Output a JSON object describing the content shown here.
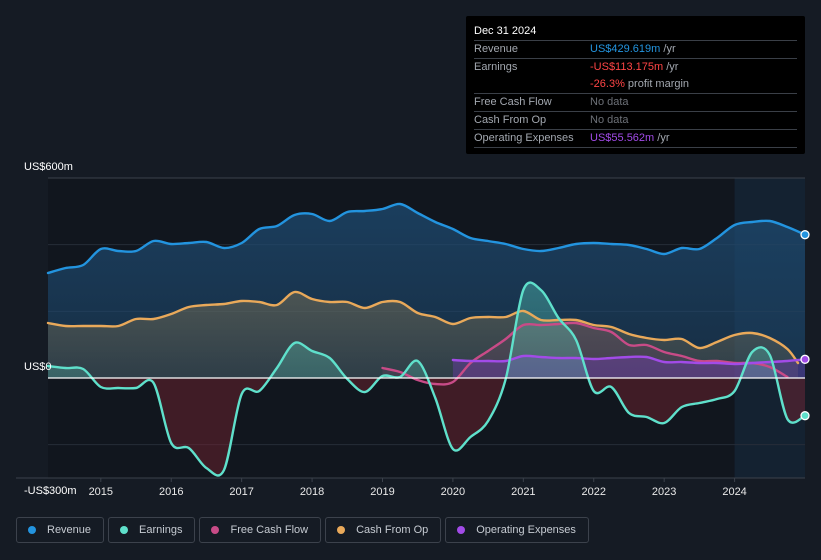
{
  "tooltip": {
    "date": "Dec 31 2024",
    "rows": [
      {
        "label": "Revenue",
        "value": "US$429.619m",
        "suffix": " /yr",
        "color": "#2394df"
      },
      {
        "label": "Earnings",
        "value": "-US$113.175m",
        "suffix": " /yr",
        "color": "#ff4545"
      },
      {
        "label": "",
        "value": "-26.3%",
        "suffix": " profit margin",
        "color": "#ff4545"
      },
      {
        "label": "Free Cash Flow",
        "value": "No data",
        "suffix": "",
        "color": ""
      },
      {
        "label": "Cash From Op",
        "value": "No data",
        "suffix": "",
        "color": ""
      },
      {
        "label": "Operating Expenses",
        "value": "US$55.562m",
        "suffix": " /yr",
        "color": "#a24be8"
      }
    ]
  },
  "legend": [
    {
      "label": "Revenue",
      "color": "#2394df"
    },
    {
      "label": "Earnings",
      "color": "#5fe0cb"
    },
    {
      "label": "Free Cash Flow",
      "color": "#c84b87"
    },
    {
      "label": "Cash From Op",
      "color": "#e9a95a"
    },
    {
      "label": "Operating Expenses",
      "color": "#a24be8"
    }
  ],
  "chart_data": {
    "type": "line",
    "title": "",
    "xlabel": "",
    "ylabel": "",
    "xlim": [
      2014.25,
      2025.0
    ],
    "ylim": [
      -300,
      600
    ],
    "y_labels": [
      {
        "value": 600,
        "label": "US$600m"
      },
      {
        "value": 0,
        "label": "US$0"
      },
      {
        "value": -300,
        "label": "-US$300m"
      }
    ],
    "y_gridlines": [
      600,
      400,
      200,
      0,
      -200,
      -300
    ],
    "x_ticks": [
      2015,
      2016,
      2017,
      2018,
      2019,
      2020,
      2021,
      2022,
      2023,
      2024
    ],
    "x_tick_labels": [
      "2015",
      "2016",
      "2017",
      "2018",
      "2019",
      "2020",
      "2021",
      "2022",
      "2023",
      "2024"
    ],
    "highlight_from": 2024.0,
    "grid": true,
    "legend_position": "bottom-left",
    "series": [
      {
        "name": "Revenue",
        "color": "#2394df",
        "end_marker": true,
        "points": [
          [
            2014.25,
            315
          ],
          [
            2014.5,
            330
          ],
          [
            2014.75,
            339
          ],
          [
            2015.0,
            387
          ],
          [
            2015.25,
            381
          ],
          [
            2015.5,
            381
          ],
          [
            2015.75,
            411
          ],
          [
            2016.0,
            402
          ],
          [
            2016.25,
            405
          ],
          [
            2016.5,
            408
          ],
          [
            2016.75,
            390
          ],
          [
            2017.0,
            405
          ],
          [
            2017.25,
            447
          ],
          [
            2017.5,
            456
          ],
          [
            2017.75,
            489
          ],
          [
            2018.0,
            492
          ],
          [
            2018.25,
            471
          ],
          [
            2018.5,
            498
          ],
          [
            2018.75,
            501
          ],
          [
            2019.0,
            507
          ],
          [
            2019.25,
            522
          ],
          [
            2019.5,
            495
          ],
          [
            2019.75,
            468
          ],
          [
            2020.0,
            447
          ],
          [
            2020.25,
            420
          ],
          [
            2020.5,
            411
          ],
          [
            2020.75,
            402
          ],
          [
            2021.0,
            387
          ],
          [
            2021.25,
            381
          ],
          [
            2021.5,
            390
          ],
          [
            2021.75,
            402
          ],
          [
            2022.0,
            405
          ],
          [
            2022.25,
            402
          ],
          [
            2022.5,
            399
          ],
          [
            2022.75,
            387
          ],
          [
            2023.0,
            372
          ],
          [
            2023.25,
            390
          ],
          [
            2023.5,
            387
          ],
          [
            2023.75,
            420
          ],
          [
            2024.0,
            459
          ],
          [
            2024.25,
            468
          ],
          [
            2024.5,
            471
          ],
          [
            2024.75,
            453
          ],
          [
            2025.0,
            430
          ]
        ]
      },
      {
        "name": "Cash From Op",
        "color": "#e9a95a",
        "end_marker": false,
        "points": [
          [
            2014.25,
            165
          ],
          [
            2014.5,
            156
          ],
          [
            2014.75,
            156
          ],
          [
            2015.0,
            156
          ],
          [
            2015.25,
            156
          ],
          [
            2015.5,
            177
          ],
          [
            2015.75,
            177
          ],
          [
            2016.0,
            192
          ],
          [
            2016.25,
            213
          ],
          [
            2016.5,
            219
          ],
          [
            2016.75,
            222
          ],
          [
            2017.0,
            231
          ],
          [
            2017.25,
            228
          ],
          [
            2017.5,
            219
          ],
          [
            2017.75,
            258
          ],
          [
            2018.0,
            237
          ],
          [
            2018.25,
            228
          ],
          [
            2018.5,
            228
          ],
          [
            2018.75,
            210
          ],
          [
            2019.0,
            228
          ],
          [
            2019.25,
            228
          ],
          [
            2019.5,
            195
          ],
          [
            2019.75,
            183
          ],
          [
            2020.0,
            162
          ],
          [
            2020.25,
            180
          ],
          [
            2020.5,
            183
          ],
          [
            2020.75,
            183
          ],
          [
            2021.0,
            201
          ],
          [
            2021.25,
            174
          ],
          [
            2021.5,
            174
          ],
          [
            2021.75,
            174
          ],
          [
            2022.0,
            159
          ],
          [
            2022.25,
            153
          ],
          [
            2022.5,
            132
          ],
          [
            2022.75,
            120
          ],
          [
            2023.0,
            114
          ],
          [
            2023.25,
            117
          ],
          [
            2023.5,
            90
          ],
          [
            2023.75,
            108
          ],
          [
            2024.0,
            129
          ],
          [
            2024.25,
            135
          ],
          [
            2024.5,
            120
          ],
          [
            2024.75,
            87
          ],
          [
            2024.9,
            45
          ]
        ]
      },
      {
        "name": "Free Cash Flow",
        "color": "#c84b87",
        "end_marker": false,
        "points": [
          [
            2019.0,
            30
          ],
          [
            2019.25,
            18
          ],
          [
            2019.5,
            -6
          ],
          [
            2019.75,
            -18
          ],
          [
            2020.0,
            -12
          ],
          [
            2020.25,
            45
          ],
          [
            2020.5,
            81
          ],
          [
            2020.75,
            117
          ],
          [
            2021.0,
            159
          ],
          [
            2021.25,
            159
          ],
          [
            2021.5,
            162
          ],
          [
            2021.75,
            165
          ],
          [
            2022.0,
            150
          ],
          [
            2022.25,
            138
          ],
          [
            2022.5,
            99
          ],
          [
            2022.75,
            99
          ],
          [
            2023.0,
            78
          ],
          [
            2023.25,
            66
          ],
          [
            2023.5,
            51
          ],
          [
            2023.75,
            51
          ],
          [
            2024.0,
            45
          ],
          [
            2024.25,
            45
          ],
          [
            2024.5,
            33
          ],
          [
            2024.75,
            3
          ]
        ]
      },
      {
        "name": "Operating Expenses",
        "color": "#a24be8",
        "end_marker": true,
        "points": [
          [
            2020.0,
            54
          ],
          [
            2020.25,
            51
          ],
          [
            2020.5,
            51
          ],
          [
            2020.75,
            51
          ],
          [
            2021.0,
            66
          ],
          [
            2021.25,
            63
          ],
          [
            2021.5,
            60
          ],
          [
            2021.75,
            60
          ],
          [
            2022.0,
            57
          ],
          [
            2022.25,
            60
          ],
          [
            2022.5,
            63
          ],
          [
            2022.75,
            63
          ],
          [
            2023.0,
            48
          ],
          [
            2023.25,
            48
          ],
          [
            2023.5,
            45
          ],
          [
            2023.75,
            45
          ],
          [
            2024.0,
            42
          ],
          [
            2024.25,
            45
          ],
          [
            2024.5,
            48
          ],
          [
            2024.75,
            51
          ],
          [
            2025.0,
            56
          ]
        ]
      },
      {
        "name": "Earnings",
        "color": "#5fe0cb",
        "end_marker": true,
        "points": [
          [
            2014.25,
            36
          ],
          [
            2014.5,
            30
          ],
          [
            2014.75,
            27
          ],
          [
            2015.0,
            -27
          ],
          [
            2015.25,
            -30
          ],
          [
            2015.5,
            -30
          ],
          [
            2015.75,
            -15
          ],
          [
            2016.0,
            -195
          ],
          [
            2016.25,
            -210
          ],
          [
            2016.5,
            -270
          ],
          [
            2016.75,
            -276
          ],
          [
            2017.0,
            -48
          ],
          [
            2017.25,
            -39
          ],
          [
            2017.5,
            30
          ],
          [
            2017.75,
            105
          ],
          [
            2018.0,
            81
          ],
          [
            2018.25,
            60
          ],
          [
            2018.5,
            -3
          ],
          [
            2018.75,
            -42
          ],
          [
            2019.0,
            6
          ],
          [
            2019.25,
            3
          ],
          [
            2019.5,
            51
          ],
          [
            2019.75,
            -60
          ],
          [
            2020.0,
            -213
          ],
          [
            2020.25,
            -177
          ],
          [
            2020.5,
            -129
          ],
          [
            2020.75,
            -3
          ],
          [
            2021.0,
            264
          ],
          [
            2021.25,
            264
          ],
          [
            2021.5,
            180
          ],
          [
            2021.75,
            114
          ],
          [
            2022.0,
            -39
          ],
          [
            2022.25,
            -27
          ],
          [
            2022.5,
            -105
          ],
          [
            2022.75,
            -117
          ],
          [
            2023.0,
            -135
          ],
          [
            2023.25,
            -87
          ],
          [
            2023.5,
            -75
          ],
          [
            2023.75,
            -63
          ],
          [
            2024.0,
            -39
          ],
          [
            2024.25,
            78
          ],
          [
            2024.5,
            69
          ],
          [
            2024.75,
            -123
          ],
          [
            2025.0,
            -113
          ]
        ]
      }
    ]
  }
}
